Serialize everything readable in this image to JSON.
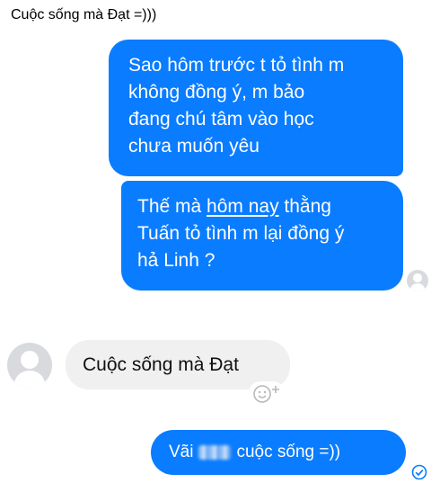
{
  "caption": "Cuộc sống mà Đạt =)))",
  "messages": [
    {
      "direction": "outgoing",
      "lines": [
        "Sao hôm trước t tỏ tình m",
        "không đồng ý, m bảo",
        "đang chú tâm vào học",
        "chưa muốn yêu"
      ]
    },
    {
      "direction": "outgoing",
      "line1_before": "Thế mà ",
      "line1_underlined": "hôm nay",
      "line1_after": " thằng",
      "lines": [
        "Tuấn tỏ tình m lại đồng ý",
        "hả Linh ?"
      ]
    },
    {
      "direction": "incoming",
      "text": "Cuộc sống mà Đạt"
    },
    {
      "direction": "outgoing",
      "text_before": "Vãi",
      "text_after": "cuộc sống =))"
    }
  ],
  "colors": {
    "outgoing_bubble": "#0a7cff",
    "incoming_bubble": "#f0f0f0",
    "avatar_placeholder": "#d8dadd",
    "sent_check": "#0a7cff"
  },
  "icons": {
    "sender_avatar": "default-avatar-icon",
    "seen_avatar": "default-avatar-icon",
    "add_reaction": "smiley-plus-icon",
    "sent_status": "check-circle-icon"
  }
}
